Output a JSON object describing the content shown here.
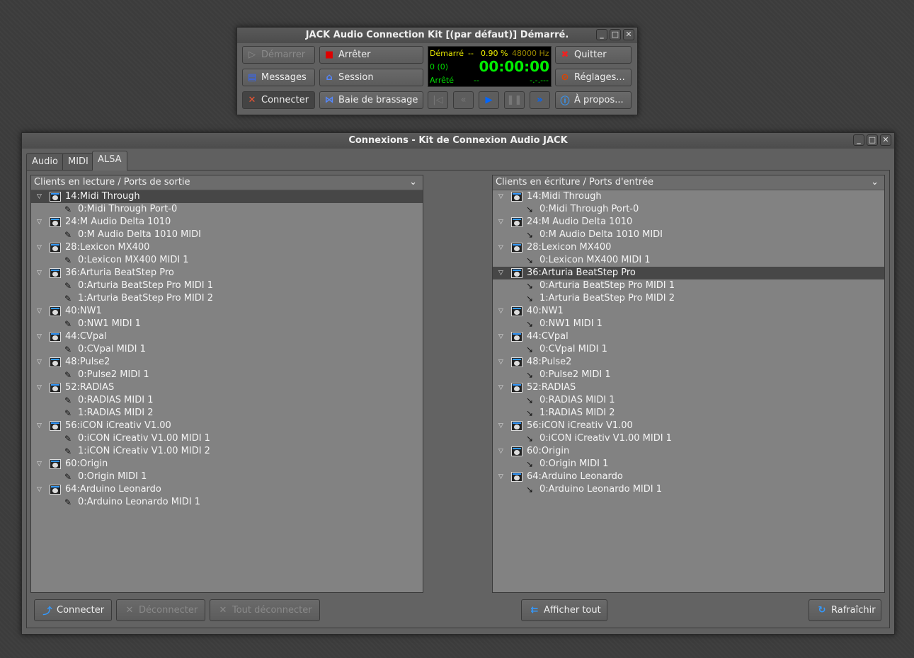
{
  "main_window": {
    "title": "JACK Audio Connection Kit [(par défaut)] Démarré.",
    "buttons": {
      "start": "Démarrer",
      "stop": "Arrêter",
      "quit": "Quitter",
      "messages": "Messages",
      "session": "Session",
      "setup": "Réglages...",
      "connect": "Connecter",
      "patchbay": "Baie de brassage",
      "about": "À propos..."
    },
    "display": {
      "state": "Démarré",
      "dash1": "--",
      "dsp_load": "0.90 %",
      "sample_rate": "48000 Hz",
      "xruns": "0 (0)",
      "time": "00:00:00",
      "transport": "Arrêté",
      "dash2": "--",
      "bbt": "-.-.---"
    }
  },
  "connections_window": {
    "title": "Connexions - Kit de Connexion Audio JACK",
    "tabs": [
      {
        "label": "Audio"
      },
      {
        "label": "MIDI"
      },
      {
        "label": "ALSA"
      }
    ],
    "left_header": "Clients en lecture / Ports de sortie",
    "right_header": "Clients en écriture / Ports d'entrée",
    "left_clients": [
      {
        "name": "14:Midi Through",
        "ports": [
          "0:Midi Through Port-0"
        ]
      },
      {
        "name": "24:M Audio Delta 1010",
        "ports": [
          "0:M Audio Delta 1010 MIDI"
        ]
      },
      {
        "name": "28:Lexicon MX400",
        "ports": [
          "0:Lexicon MX400 MIDI 1"
        ]
      },
      {
        "name": "36:Arturia BeatStep Pro",
        "ports": [
          "0:Arturia BeatStep Pro MIDI 1",
          "1:Arturia BeatStep Pro MIDI 2"
        ]
      },
      {
        "name": "40:NW1",
        "ports": [
          "0:NW1 MIDI 1"
        ]
      },
      {
        "name": "44:CVpal",
        "ports": [
          "0:CVpal MIDI 1"
        ]
      },
      {
        "name": "48:Pulse2",
        "ports": [
          "0:Pulse2 MIDI 1"
        ]
      },
      {
        "name": "52:RADIAS",
        "ports": [
          "0:RADIAS MIDI 1",
          "1:RADIAS MIDI 2"
        ]
      },
      {
        "name": "56:iCON iCreativ V1.00",
        "ports": [
          "0:iCON iCreativ V1.00 MIDI 1",
          "1:iCON iCreativ V1.00 MIDI 2"
        ]
      },
      {
        "name": "60:Origin",
        "ports": [
          "0:Origin MIDI 1"
        ]
      },
      {
        "name": "64:Arduino Leonardo",
        "ports": [
          "0:Arduino Leonardo MIDI 1"
        ]
      }
    ],
    "right_clients": [
      {
        "name": "14:Midi Through",
        "ports": [
          "0:Midi Through Port-0"
        ]
      },
      {
        "name": "24:M Audio Delta 1010",
        "ports": [
          "0:M Audio Delta 1010 MIDI"
        ]
      },
      {
        "name": "28:Lexicon MX400",
        "ports": [
          "0:Lexicon MX400 MIDI 1"
        ]
      },
      {
        "name": "36:Arturia BeatStep Pro",
        "ports": [
          "0:Arturia BeatStep Pro MIDI 1",
          "1:Arturia BeatStep Pro MIDI 2"
        ]
      },
      {
        "name": "40:NW1",
        "ports": [
          "0:NW1 MIDI 1"
        ]
      },
      {
        "name": "44:CVpal",
        "ports": [
          "0:CVpal MIDI 1"
        ]
      },
      {
        "name": "48:Pulse2",
        "ports": [
          "0:Pulse2 MIDI 1"
        ]
      },
      {
        "name": "52:RADIAS",
        "ports": [
          "0:RADIAS MIDI 1",
          "1:RADIAS MIDI 2"
        ]
      },
      {
        "name": "56:iCON iCreativ V1.00",
        "ports": [
          "0:iCON iCreativ V1.00 MIDI 1"
        ]
      },
      {
        "name": "60:Origin",
        "ports": [
          "0:Origin MIDI 1"
        ]
      },
      {
        "name": "64:Arduino Leonardo",
        "ports": [
          "0:Arduino Leonardo MIDI 1"
        ]
      }
    ],
    "left_selected": "14:Midi Through",
    "right_selected": "36:Arturia BeatStep Pro",
    "buttons": {
      "connect": "Connecter",
      "disconnect": "Déconnecter",
      "disconnect_all": "Tout déconnecter",
      "show_all": "Afficher tout",
      "refresh": "Rafraîchir"
    }
  }
}
